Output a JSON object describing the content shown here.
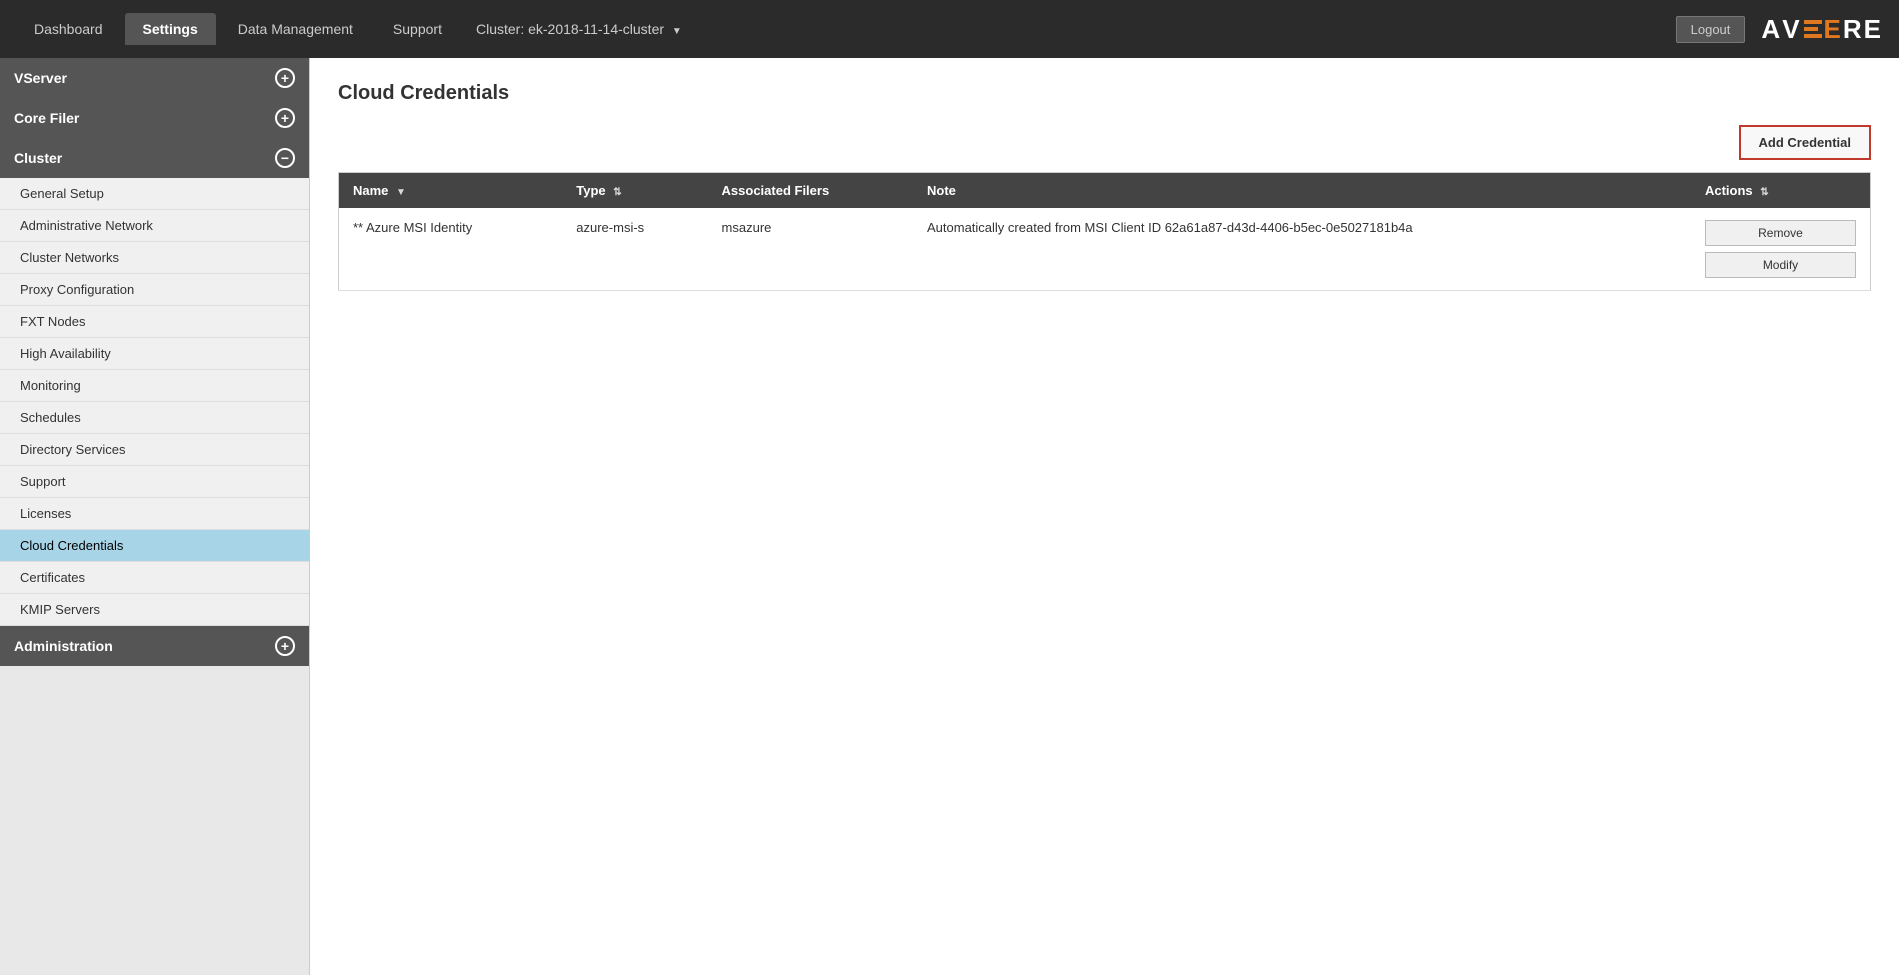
{
  "topbar": {
    "tabs": [
      {
        "id": "dashboard",
        "label": "Dashboard",
        "active": false
      },
      {
        "id": "settings",
        "label": "Settings",
        "active": true
      },
      {
        "id": "data-management",
        "label": "Data Management",
        "active": false
      },
      {
        "id": "support",
        "label": "Support",
        "active": false
      }
    ],
    "cluster_label": "Cluster: ek-2018-11-14-cluster",
    "logout_label": "Logout",
    "logo_text_A": "A",
    "logo_text_V": "V",
    "logo_text_E": "E",
    "logo_text_R": "R",
    "logo_text_E2": "E"
  },
  "sidebar": {
    "sections": [
      {
        "id": "vserver",
        "label": "VServer",
        "icon": "+",
        "items": []
      },
      {
        "id": "core-filer",
        "label": "Core Filer",
        "icon": "+",
        "items": []
      },
      {
        "id": "cluster",
        "label": "Cluster",
        "icon": "−",
        "items": [
          {
            "id": "general-setup",
            "label": "General Setup",
            "active": false
          },
          {
            "id": "administrative-network",
            "label": "Administrative Network",
            "active": false
          },
          {
            "id": "cluster-networks",
            "label": "Cluster Networks",
            "active": false
          },
          {
            "id": "proxy-configuration",
            "label": "Proxy Configuration",
            "active": false
          },
          {
            "id": "fxt-nodes",
            "label": "FXT Nodes",
            "active": false
          },
          {
            "id": "high-availability",
            "label": "High Availability",
            "active": false
          },
          {
            "id": "monitoring",
            "label": "Monitoring",
            "active": false
          },
          {
            "id": "schedules",
            "label": "Schedules",
            "active": false
          },
          {
            "id": "directory-services",
            "label": "Directory Services",
            "active": false
          },
          {
            "id": "support",
            "label": "Support",
            "active": false
          },
          {
            "id": "licenses",
            "label": "Licenses",
            "active": false
          },
          {
            "id": "cloud-credentials",
            "label": "Cloud Credentials",
            "active": true
          },
          {
            "id": "certificates",
            "label": "Certificates",
            "active": false
          },
          {
            "id": "kmip-servers",
            "label": "KMIP Servers",
            "active": false
          }
        ]
      },
      {
        "id": "administration",
        "label": "Administration",
        "icon": "+",
        "items": []
      }
    ]
  },
  "main": {
    "page_title": "Cloud Credentials",
    "add_credential_label": "Add Credential",
    "table": {
      "columns": [
        {
          "id": "name",
          "label": "Name",
          "sortable": true
        },
        {
          "id": "type",
          "label": "Type",
          "sortable": true
        },
        {
          "id": "associated-filers",
          "label": "Associated Filers",
          "sortable": false
        },
        {
          "id": "note",
          "label": "Note",
          "sortable": false
        },
        {
          "id": "actions",
          "label": "Actions",
          "sortable": true
        }
      ],
      "rows": [
        {
          "name": "** Azure MSI Identity",
          "type": "azure-msi-s",
          "associated_filers": "msazure",
          "note": "Automatically created from MSI Client ID 62a61a87-d43d-4406-b5ec-0e5027181b4a",
          "actions": [
            "Remove",
            "Modify"
          ]
        }
      ]
    }
  }
}
